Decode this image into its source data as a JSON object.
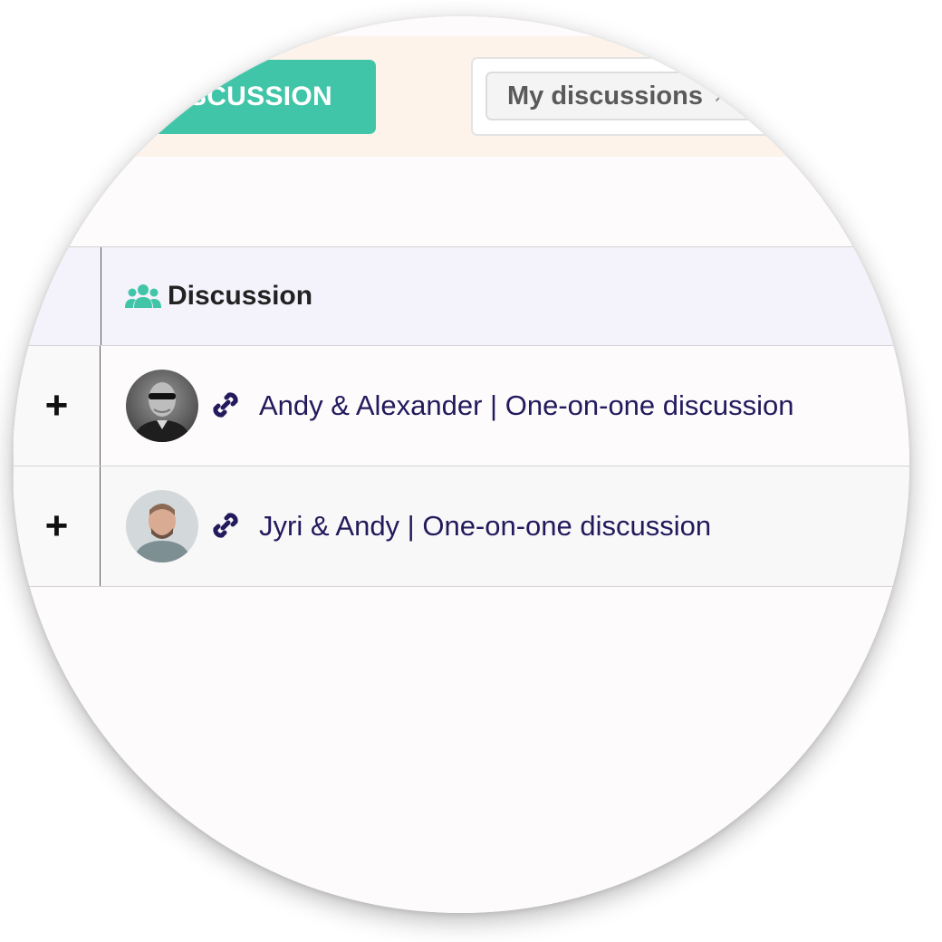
{
  "toolbar": {
    "new_discussion_label": "DISCUSSION",
    "filter_chip_label": "My discussions",
    "filter_chip_remove": "×"
  },
  "table": {
    "header": {
      "discussion_label": "Discussion"
    },
    "rows": [
      {
        "expand": "+",
        "title": "Andy & Alexander | One-on-one discussion"
      },
      {
        "expand": "+",
        "title": "Jyri & Andy | One-on-one discussion"
      }
    ]
  },
  "colors": {
    "accent": "#41c5a8",
    "top_bar_bg": "#fdf3ea",
    "header_bg": "#f4f3fc",
    "link_text": "#221a5c"
  },
  "icons": {
    "header_icon": "users-icon",
    "row_link_icon": "link-icon",
    "row_expand_icon": "plus-icon"
  }
}
